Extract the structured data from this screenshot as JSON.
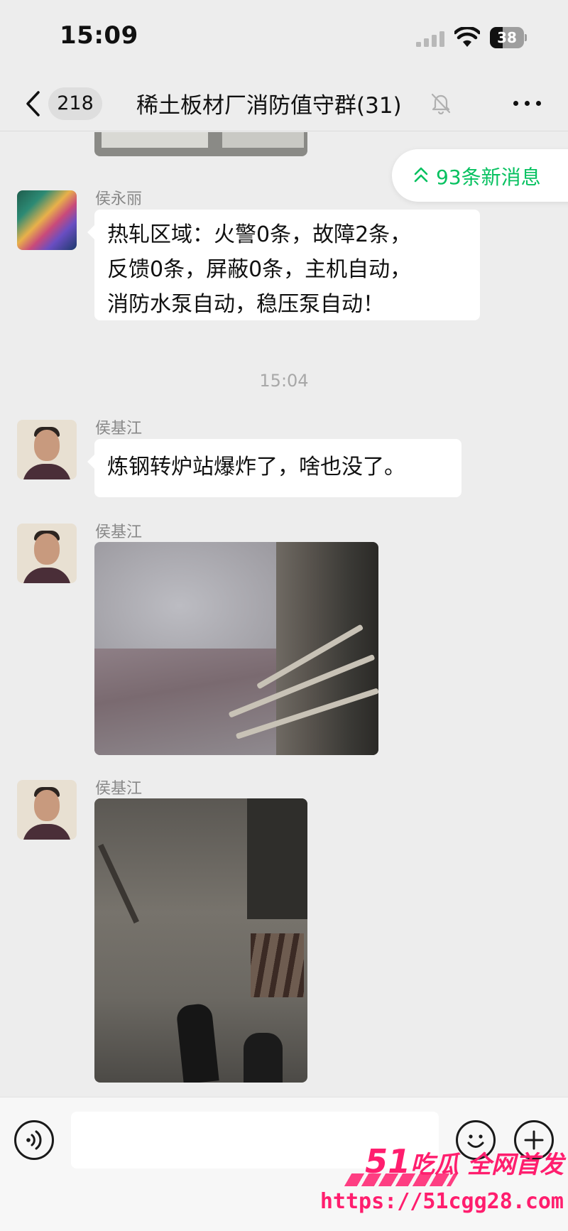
{
  "status_bar": {
    "time": "15:09",
    "battery_level": "38",
    "battery_fraction": 0.38
  },
  "nav": {
    "unread_count": "218",
    "title": "稀土板材厂消防值守群(31)",
    "muted": true
  },
  "new_messages_pill": "93条新消息",
  "messages": [
    {
      "sender": "侯永丽",
      "type": "text",
      "lines": [
        "热轧区域：火警0条，故障2条，",
        "反馈0条，屏蔽0条，主机自动，",
        "消防水泵自动，稳压泵自动！"
      ]
    },
    {
      "type": "time",
      "time": "15:04"
    },
    {
      "sender": "侯基江",
      "type": "text",
      "lines": [
        "炼钢转炉站爆炸了，啥也没了。"
      ]
    },
    {
      "sender": "侯基江",
      "type": "image"
    },
    {
      "sender": "侯基江",
      "type": "image"
    }
  ],
  "watermark": {
    "num": "51",
    "text": "吃瓜 全网首发",
    "url": "https://51cgg28.com"
  },
  "colors": {
    "accent_green": "#07c160",
    "background": "#ededed",
    "watermark": "#ff1e6e"
  },
  "icons": [
    "signal-icon",
    "wifi-icon",
    "battery-icon",
    "back-chevron-icon",
    "mute-bell-icon",
    "more-icon",
    "double-chevron-up-icon",
    "voice-icon",
    "emoji-icon",
    "plus-icon"
  ]
}
